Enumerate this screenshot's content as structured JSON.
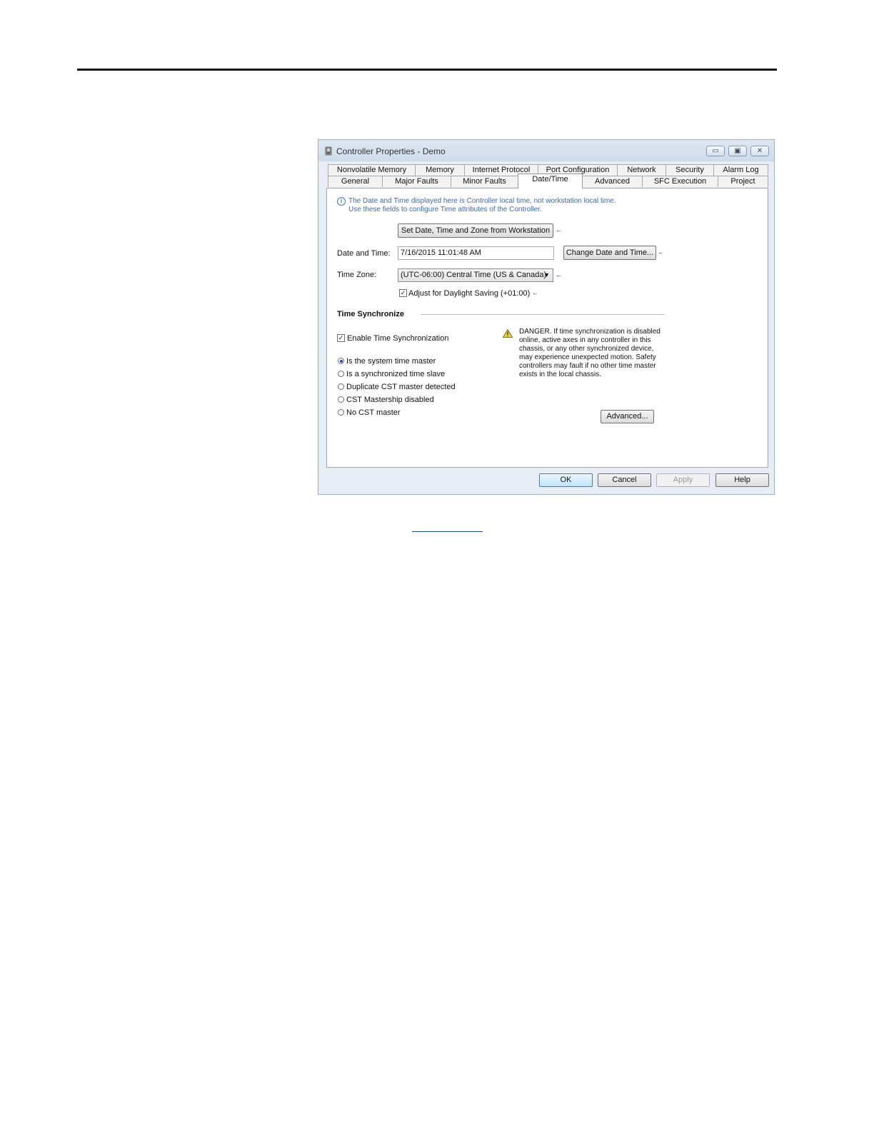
{
  "window": {
    "title": "Controller Properties - Demo",
    "min_glyph": "▭",
    "max_glyph": "▣",
    "close_glyph": "✕",
    "app_icon": "controller-gear-icon"
  },
  "tabs_row1": [
    {
      "label": "Nonvolatile Memory"
    },
    {
      "label": "Memory"
    },
    {
      "label": "Internet Protocol"
    },
    {
      "label": "Port Configuration"
    },
    {
      "label": "Network"
    },
    {
      "label": "Security"
    },
    {
      "label": "Alarm Log"
    }
  ],
  "tabs_row2": [
    {
      "label": "General"
    },
    {
      "label": "Major Faults"
    },
    {
      "label": "Minor Faults"
    },
    {
      "label": "Date/Time",
      "active": true
    },
    {
      "label": "Advanced"
    },
    {
      "label": "SFC Execution"
    },
    {
      "label": "Project"
    }
  ],
  "info": {
    "icon": "info-icon",
    "line1": "The Date and Time displayed here is Controller local time, not workstation local time.",
    "line2": "Use these fields to configure Time attributes of the Controller."
  },
  "set_from_workstation_label": "Set Date, Time and Zone from Workstation",
  "date_time": {
    "label": "Date and Time:",
    "value": "7/16/2015 11:01:48 AM",
    "change_button_label": "Change Date and Time..."
  },
  "time_zone": {
    "label": "Time Zone:",
    "value": "(UTC-06:00) Central Time (US & Canada)",
    "caret": "▼"
  },
  "daylight_saving": {
    "label": "Adjust for Daylight Saving (+01:00)",
    "checked": true
  },
  "arrow_glyph": "←",
  "check_glyph": "✓",
  "time_sync": {
    "section_title": "Time Synchronize",
    "enable_label": "Enable Time Synchronization",
    "enable_checked": true,
    "options": [
      {
        "label": "Is the system time master",
        "selected": true
      },
      {
        "label": "Is a synchronized time slave",
        "selected": false
      },
      {
        "label": "Duplicate CST master detected",
        "selected": false
      },
      {
        "label": "CST Mastership disabled",
        "selected": false
      },
      {
        "label": "No CST master",
        "selected": false
      }
    ],
    "danger_icon": "warning-triangle-icon",
    "danger_lines": [
      "DANGER. If time synchronization is disabled",
      "online, active axes in any controller in this",
      "chassis, or any other synchronized device,",
      "may experience unexpected motion.  Safety",
      "controllers may fault if no other time master",
      "exists in the local chassis."
    ],
    "advanced_button_label": "Advanced..."
  },
  "footer": {
    "ok_label": "OK",
    "cancel_label": "Cancel",
    "apply_label": "Apply",
    "help_label": "Help"
  }
}
